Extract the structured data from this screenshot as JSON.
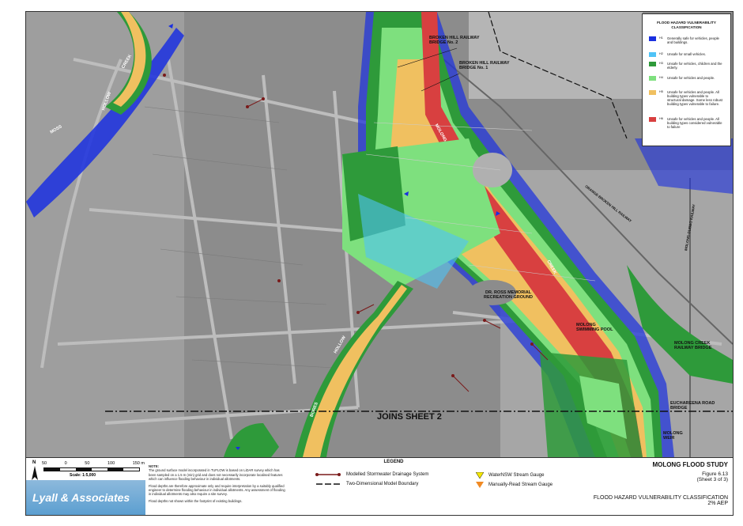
{
  "map": {
    "labels": {
      "broken_hill_2": "BROKEN HILL RAILWAY BRIDGE No. 2",
      "broken_hill_1": "BROKEN HILL RAILWAY BRIDGE No. 1",
      "molong_river": "MOLONG",
      "creek": "CREEK",
      "hollow_creek": "HOLLOW",
      "creek2": "CREEK",
      "moss": "MOSS",
      "ross": "DR. ROSS MEMORIAL RECREATION GROUND",
      "swimming": "MOLONG SWIMMING POOL",
      "molong_creek_rail": "MOLONG CREEK RAILWAY BRIDGE",
      "euchareena": "EUCHAREENA ROAD BRIDGE",
      "weir": "MOLONG WEIR",
      "joins": "JOINS SHEET 2",
      "railway": "ORANGE-BROKEN HILL RAILWAY",
      "dubbo_rail": "MOLONG-DUBBO RAILWAY",
      "hollow2": "HOLLOW",
      "bores": "BORES"
    },
    "colors": {
      "h1": "#1a2fe0",
      "h2": "#4fc3f7",
      "h3": "#2e9a3a",
      "h4": "#7ee07e",
      "h5": "#f0c060",
      "h6": "#d84040"
    }
  },
  "legend_box": {
    "title": "FLOOD HAZARD VULNERABILITY CLASSIFICATION",
    "items": [
      {
        "code": "H1",
        "desc": "Generally safe for vehicles, people and buildings.",
        "color": "#1a2fe0"
      },
      {
        "code": "H2",
        "desc": "Unsafe for small vehicles.",
        "color": "#4fc3f7"
      },
      {
        "code": "H3",
        "desc": "Unsafe for vehicles, children and the elderly.",
        "color": "#2e9a3a"
      },
      {
        "code": "H4",
        "desc": "Unsafe for vehicles and people.",
        "color": "#7ee07e"
      },
      {
        "code": "H5",
        "desc": "Unsafe for vehicles and people. All building types vulnerable to structural damage. Some less robust building types vulnerable to failure.",
        "color": "#f0c060"
      },
      {
        "code": "H6",
        "desc": "Unsafe for vehicles and people. All building types considered vulnerable to failure",
        "color": "#d84040"
      }
    ]
  },
  "footer": {
    "scale_ticks": [
      "50",
      "0",
      "50",
      "100",
      "150 m"
    ],
    "scale_text": "Scale: 1:5,000",
    "north": "N",
    "logo_text": "Lyall & Associates",
    "note_title": "NOTE:",
    "note_1": "The ground surface model incorporated in TUFLOW is based on LiDAR survey which has been sampled on a 1.5 m (min) grid and does not necessarily incorporate localised features which can influence flooding behaviour in individual allotments.",
    "note_2": "Flood depths are therefore approximate only and require interpretation by a suitably qualified engineer to determine flooding behaviour in individual allotments. Any assessment of flooding in individual allotments may also require a site survey.",
    "note_3": "Flood depths not shown within the footprint of existing buildings.",
    "legend_title": "LEGEND",
    "legend_stormwater": "Modelled Stormwater Drainage System",
    "legend_boundary": "Two-Dimensional Model Boundary",
    "legend_water_nsw": "WaterNSW Stream Gauge",
    "legend_manual": "Manually-Read Stream Gauge",
    "study": "MOLONG FLOOD STUDY",
    "figure": "Figure 6.13",
    "sheet": "(Sheet 3 of 3)",
    "class_title": "FLOOD HAZARD VULNERABILITY CLASSIFICATION",
    "aep": "2% AEP"
  }
}
